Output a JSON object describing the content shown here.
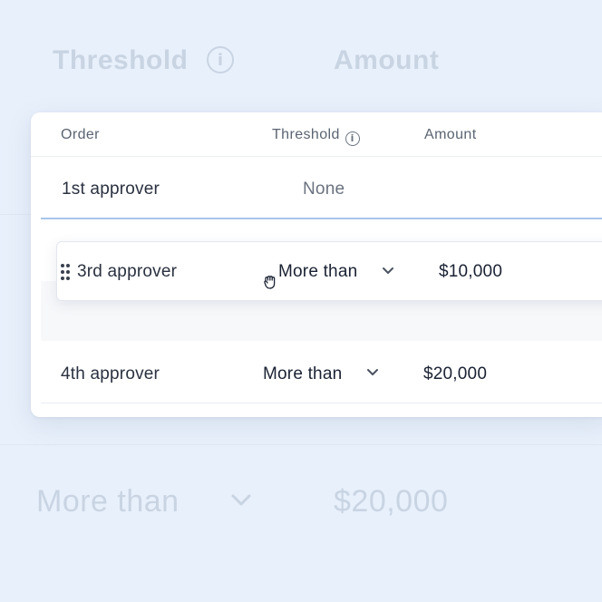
{
  "background": {
    "header_threshold": "Threshold",
    "header_amount": "Amount",
    "row_threshold": "More than",
    "row_amount": "$20,000"
  },
  "table": {
    "columns": {
      "order": "Order",
      "threshold": "Threshold",
      "amount": "Amount"
    },
    "rows": [
      {
        "order": "1st approver",
        "threshold": "None",
        "amount": ""
      },
      {
        "order": "3rd approver",
        "threshold": "More than",
        "amount": "$10,000",
        "state": "dragging"
      },
      {
        "order": "4th approver",
        "threshold": "More than",
        "amount": "$20,000"
      }
    ]
  },
  "icons": [
    "info-icon",
    "drag-handle-icon",
    "chevron-down-icon",
    "grab-hand-cursor-icon"
  ],
  "colors": {
    "accent_drop_line": "#a7c6ec",
    "text_primary": "#1a2233",
    "text_muted": "#5b6472"
  }
}
